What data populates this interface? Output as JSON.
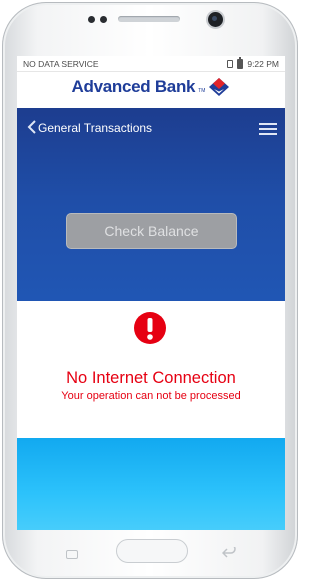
{
  "status_bar": {
    "carrier": "NO DATA SERVICE",
    "time": "9:22 PM"
  },
  "brand": {
    "name": "Advanced Bank",
    "trademark": "TM",
    "colors": {
      "primary": "#1f3d99",
      "logo_red": "#e2242a"
    }
  },
  "nav": {
    "title": "General Transactions",
    "back_icon": "chevron-left-icon",
    "menu_icon": "hamburger-menu-icon"
  },
  "main": {
    "check_balance_label": "Check Balance"
  },
  "alert": {
    "icon": "exclamation-circle-icon",
    "title": "No Internet Connection",
    "message": "Your operation can not be processed",
    "color": "#e60012"
  }
}
